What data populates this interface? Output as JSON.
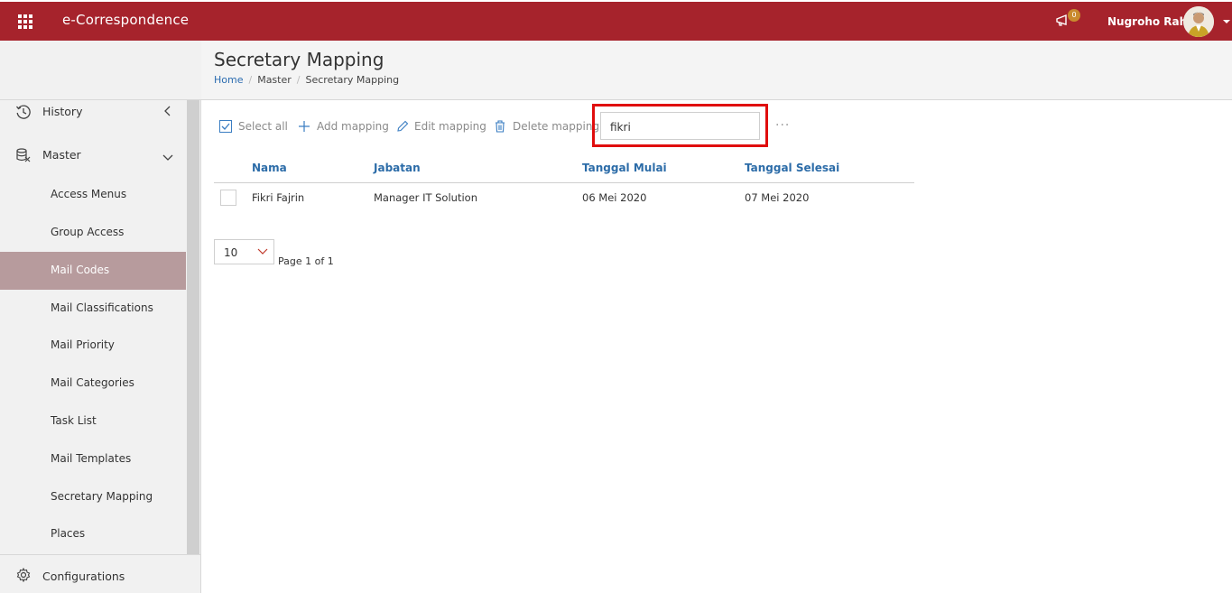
{
  "app": {
    "title": "e-Correspondence"
  },
  "header": {
    "notification_count": "0",
    "username": "Nugroho Rahm"
  },
  "sidebar": {
    "groups": [
      {
        "label": "History",
        "icon": "history-icon"
      },
      {
        "label": "Master",
        "icon": "database-icon"
      }
    ],
    "items": [
      {
        "label": "Access Menus"
      },
      {
        "label": "Group Access"
      },
      {
        "label": "Mail Codes"
      },
      {
        "label": "Mail Classifications"
      },
      {
        "label": "Mail Priority"
      },
      {
        "label": "Mail Categories"
      },
      {
        "label": "Task List"
      },
      {
        "label": "Mail Templates"
      },
      {
        "label": "Secretary Mapping"
      },
      {
        "label": "Places"
      }
    ],
    "active_item": "Mail Codes",
    "bottom": {
      "label": "Configurations",
      "icon": "gear-icon"
    }
  },
  "page": {
    "title": "Secretary Mapping",
    "breadcrumb": [
      "Home",
      "Master",
      "Secretary Mapping"
    ]
  },
  "toolbar": {
    "select_all": "Select all",
    "add": "Add mapping",
    "edit": "Edit mapping",
    "delete": "Delete mapping",
    "search_value": "fikri",
    "more": "···"
  },
  "table": {
    "columns": [
      "Nama",
      "Jabatan",
      "Tanggal Mulai",
      "Tanggal Selesai"
    ],
    "rows": [
      [
        "Fikri Fajrin",
        "Manager IT Solution",
        "06 Mei 2020",
        "07 Mei 2020"
      ]
    ]
  },
  "pagination": {
    "page_size": "10",
    "info": "Page 1 of 1"
  },
  "colors": {
    "brand": "#a6232c",
    "active_nav": "#b79b9d",
    "link": "#2c6ca8",
    "highlight": "#e00d0d"
  }
}
